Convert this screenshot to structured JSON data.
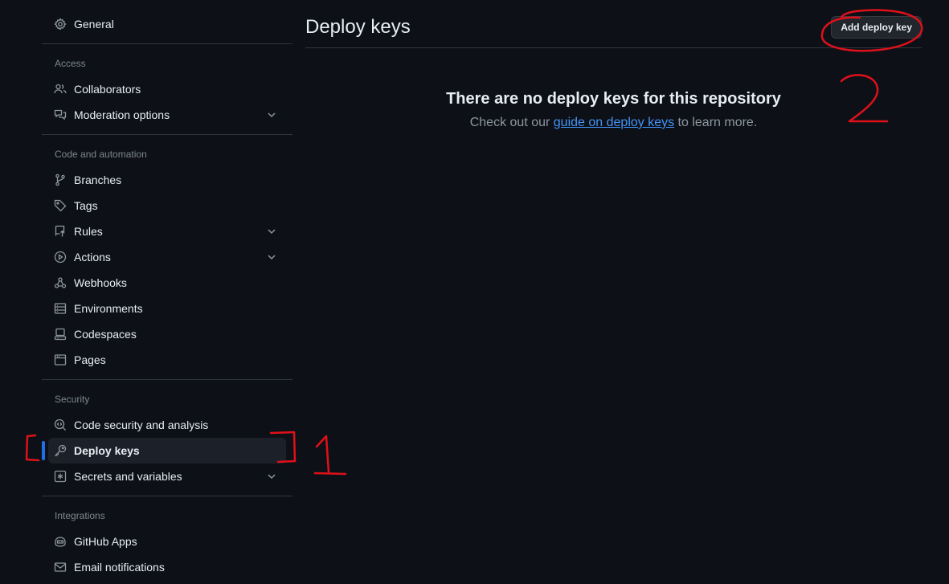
{
  "sidebar": {
    "general": "General",
    "groups": {
      "access": "Access",
      "code_automation": "Code and automation",
      "security": "Security",
      "integrations": "Integrations"
    },
    "items": {
      "collaborators": "Collaborators",
      "moderation": "Moderation options",
      "branches": "Branches",
      "tags": "Tags",
      "rules": "Rules",
      "actions": "Actions",
      "webhooks": "Webhooks",
      "environments": "Environments",
      "codespaces": "Codespaces",
      "pages": "Pages",
      "code_security": "Code security and analysis",
      "deploy_keys": "Deploy keys",
      "secrets": "Secrets and variables",
      "github_apps": "GitHub Apps",
      "email_notifications": "Email notifications"
    },
    "active": "deploy_keys"
  },
  "main": {
    "title": "Deploy keys",
    "add_button": "Add deploy key",
    "blank_title": "There are no deploy keys for this repository",
    "blank_text_before": "Check out our ",
    "blank_link": "guide on deploy keys",
    "blank_text_after": " to learn more."
  },
  "annotations": {
    "label_1": "1",
    "label_2": "2",
    "color": "#e0101a"
  },
  "colors": {
    "background": "#0d1117",
    "accent": "#1f6feb",
    "link": "#4493f8",
    "muted": "#7d8590",
    "border": "#30363d"
  }
}
